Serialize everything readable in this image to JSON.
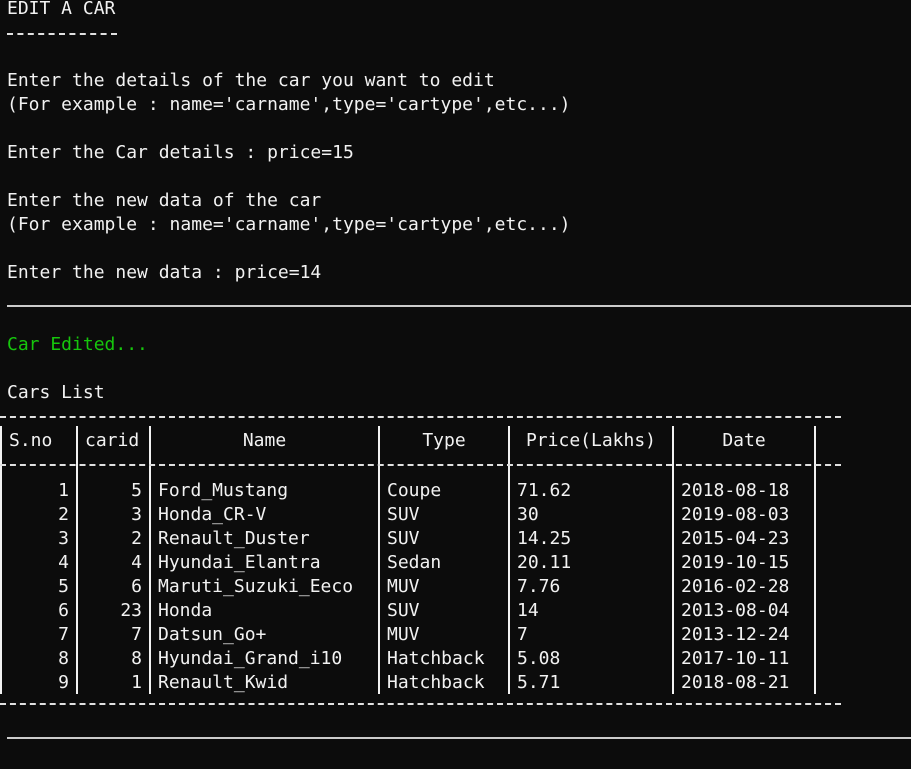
{
  "terminal": {
    "heading": "EDIT A CAR",
    "prompt1": "Enter the details of the car you want to edit",
    "example1": "(For example : name='carname',type='cartype',etc...)",
    "input1": "Enter the Car details : price=15",
    "prompt2": "Enter the new data of the car",
    "example2": "(For example : name='carname',type='cartype',etc...)",
    "input2": "Enter the new data : price=14",
    "status": "Car Edited...",
    "list_title": "Cars List"
  },
  "colors": {
    "background": "#0c0c0c",
    "text": "#f2f2f2",
    "success": "#16c60c"
  },
  "table": {
    "headers": [
      "S.no",
      "carid",
      "Name",
      "Type",
      "Price(Lakhs)",
      "Date"
    ],
    "rows": [
      [
        "1",
        "5",
        "Ford_Mustang",
        "Coupe",
        "71.62",
        "2018-08-18"
      ],
      [
        "2",
        "3",
        "Honda_CR-V",
        "SUV",
        "30",
        "2019-08-03"
      ],
      [
        "3",
        "2",
        "Renault_Duster",
        "SUV",
        "14.25",
        "2015-04-23"
      ],
      [
        "4",
        "4",
        "Hyundai_Elantra",
        "Sedan",
        "20.11",
        "2019-10-15"
      ],
      [
        "5",
        "6",
        "Maruti_Suzuki_Eeco",
        "MUV",
        "7.76",
        "2016-02-28"
      ],
      [
        "6",
        "23",
        "Honda",
        "SUV",
        "14",
        "2013-08-04"
      ],
      [
        "7",
        "7",
        "Datsun_Go+",
        "MUV",
        "7",
        "2013-12-24"
      ],
      [
        "8",
        "8",
        "Hyundai_Grand_i10",
        "Hatchback",
        "5.08",
        "2017-10-11"
      ],
      [
        "9",
        "1",
        "Renault_Kwid",
        "Hatchback",
        "5.71",
        "2018-08-21"
      ]
    ]
  }
}
